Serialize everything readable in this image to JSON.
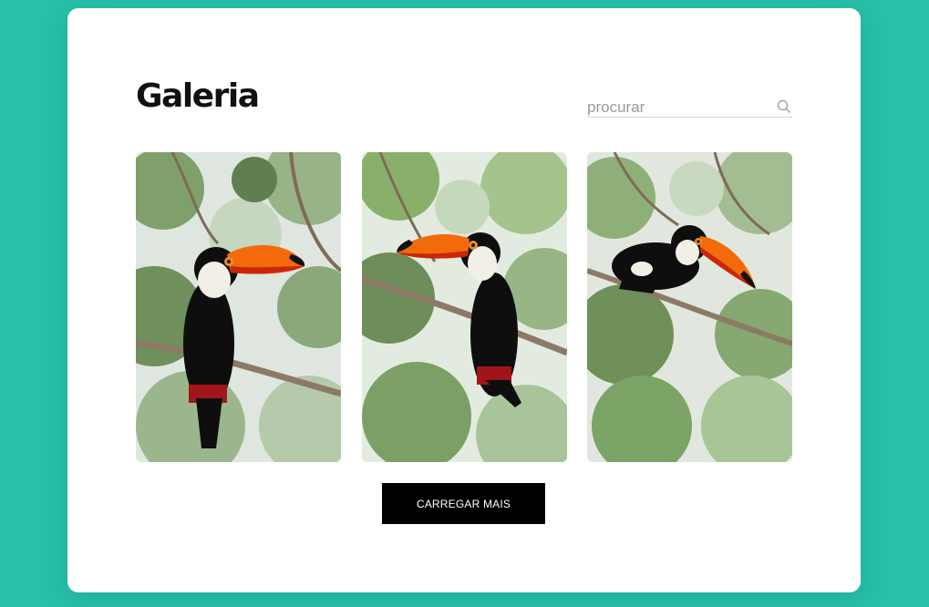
{
  "gallery": {
    "title": "Galeria",
    "search": {
      "placeholder": "procurar",
      "value": "",
      "icon": "search-icon"
    },
    "photos": [
      {
        "subject": "toucan perched on branch, facing right"
      },
      {
        "subject": "toucan perched on branch, facing left"
      },
      {
        "subject": "toucan perched on branch, leaning forward"
      }
    ],
    "load_more_label": "CARREGAR MAIS"
  },
  "colors": {
    "background": "#27c0a8",
    "card": "#ffffff",
    "button": "#000000",
    "button_text": "#ffffff",
    "beak": "#f26a0a",
    "beak_tip": "#111111"
  }
}
